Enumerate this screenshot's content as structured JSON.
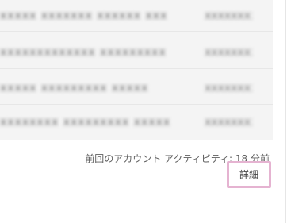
{
  "email_list": {
    "rows": [
      {
        "snippet": "xxxxx xxxxxxx xxxxxx  xxx",
        "date": "xxxxxxxx"
      },
      {
        "snippet": "xxxxxxxxxxxxx  xxxxxxxxx",
        "date": "xxxxxxxx"
      },
      {
        "snippet": "xxxxx  xxxxxxxxx  xxxxx",
        "date": "xxxxxxxx"
      },
      {
        "snippet": "xxxxxxxx xxxxxxxxx  xxxxx",
        "date": "xxxxxxxx"
      }
    ]
  },
  "footer": {
    "last_activity": "前回のアカウント アクティビティ: 18 分前",
    "details_link": "詳細"
  },
  "colors": {
    "highlight_border": "#e5b3d1",
    "list_background": "#f3f3f3",
    "text_gray": "#5f5f5f"
  }
}
